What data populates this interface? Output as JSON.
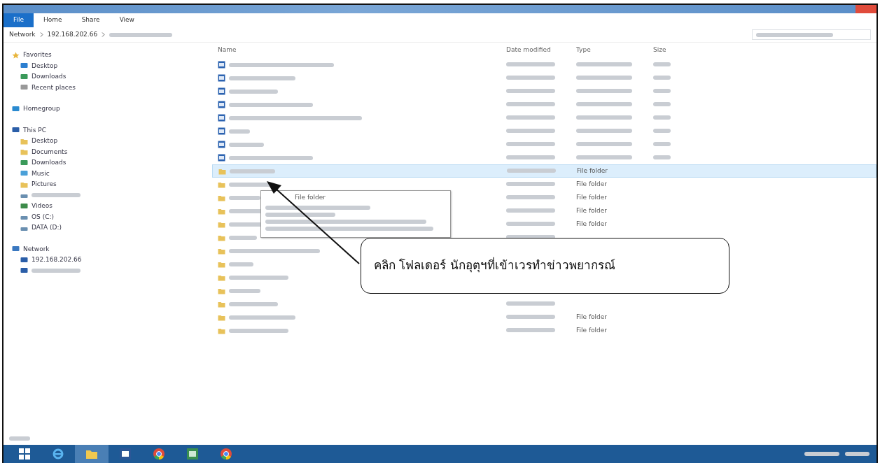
{
  "window": {
    "ribbon_tabs": [
      {
        "label": "File",
        "selected": true
      },
      {
        "label": "Home",
        "selected": false
      },
      {
        "label": "Share",
        "selected": false
      },
      {
        "label": "View",
        "selected": false
      }
    ],
    "address": [
      "Network",
      "192.168.202.66"
    ]
  },
  "sidebar": [
    {
      "label": "Favorites",
      "children": [
        {
          "label": "Desktop"
        },
        {
          "label": "Downloads"
        },
        {
          "label": "Recent places"
        }
      ]
    },
    {
      "label": "Homegroup"
    },
    {
      "label": "This PC",
      "children": [
        {
          "label": "Desktop"
        },
        {
          "label": "Documents"
        },
        {
          "label": "Downloads"
        },
        {
          "label": "Music"
        },
        {
          "label": "Pictures"
        },
        {
          "kind": "blurred"
        },
        {
          "label": "Videos"
        },
        {
          "label": "OS (C:)"
        },
        {
          "label": "DATA (D:)"
        }
      ]
    },
    {
      "label": "Network",
      "children": [
        {
          "label": "192.168.202.66"
        },
        {
          "kind": "blurred"
        }
      ]
    }
  ],
  "table": {
    "columns": [
      "Name",
      "Date modified",
      "Type",
      "Size"
    ],
    "rows": [
      {
        "kind": "document",
        "selected": false
      },
      {
        "kind": "document",
        "selected": false
      },
      {
        "kind": "document",
        "selected": false
      },
      {
        "kind": "document",
        "selected": false
      },
      {
        "kind": "document",
        "selected": false
      },
      {
        "kind": "document",
        "selected": false
      },
      {
        "kind": "document",
        "selected": false
      },
      {
        "kind": "document",
        "selected": false
      },
      {
        "kind": "folder",
        "selected": true,
        "type": "File folder"
      },
      {
        "kind": "folder",
        "selected": false,
        "type": "File folder"
      },
      {
        "kind": "folder",
        "selected": false,
        "type": "File folder"
      },
      {
        "kind": "folder",
        "selected": false,
        "type": "File folder"
      },
      {
        "kind": "folder",
        "selected": false,
        "type": "File folder"
      },
      {
        "kind": "folder",
        "selected": false
      },
      {
        "kind": "folder",
        "selected": false
      },
      {
        "kind": "folder",
        "selected": false
      },
      {
        "kind": "folder",
        "selected": false
      },
      {
        "kind": "folder",
        "selected": false
      },
      {
        "kind": "folder",
        "selected": false
      },
      {
        "kind": "folder",
        "selected": false,
        "type": "File folder"
      },
      {
        "kind": "folder",
        "selected": false,
        "type": "File folder"
      }
    ]
  },
  "tooltip": {
    "lines": [
      "File folder"
    ]
  },
  "callout": {
    "text": "คลิก โฟลเดอร์  นักอุตุฯที่เข้าเวรทำข่าวพยากรณ์"
  },
  "taskbar": [
    {
      "active": false
    },
    {
      "active": true
    },
    {
      "active": false
    },
    {
      "active": false
    },
    {
      "active": false
    },
    {
      "active": false
    }
  ]
}
